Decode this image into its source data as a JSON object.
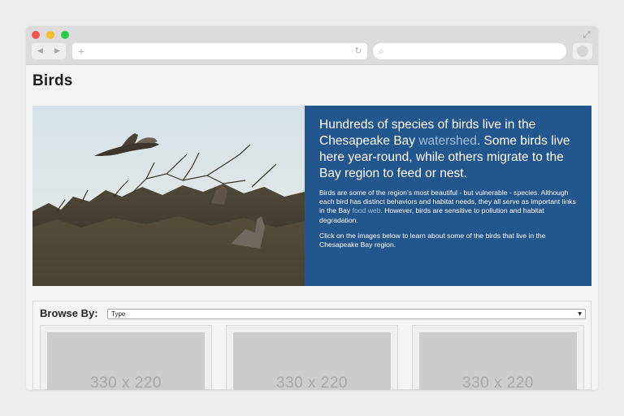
{
  "browser": {
    "back_icon": "◀",
    "forward_icon": "▶",
    "new_tab_icon": "+",
    "reload_icon": "↻",
    "search_icon": "⌕",
    "expand_icon": "⤢"
  },
  "page": {
    "title": "Birds"
  },
  "hero": {
    "lead_part1": "Hundreds of species of birds live in the Chesapeake Bay ",
    "lead_link": "watershed",
    "lead_part2": ". Some birds live here year-round, while others migrate to the Bay region to feed or nest.",
    "p1_part1": "Birds are some of the region’s most beautiful - but vulnerable - species. Although each bird has distinct behaviors and habitat needs, they all serve as important links in the Bay ",
    "p1_link": "food web",
    "p1_part2": ". However, birds are sensitive to pollution and habitat degradation.",
    "p2": "Click on the images below to learn about some of the birds that live in the Chesapeake Bay region."
  },
  "browse": {
    "label": "Browse By:",
    "selected": "Type",
    "caret": "▼",
    "cards": [
      {
        "placeholder": "330 x 220"
      },
      {
        "placeholder": "330 x 220"
      },
      {
        "placeholder": "330 x 220"
      }
    ]
  },
  "colors": {
    "panel_bg": "#22568c",
    "link": "#9fbfdd",
    "chrome": "#dcdcdc"
  }
}
